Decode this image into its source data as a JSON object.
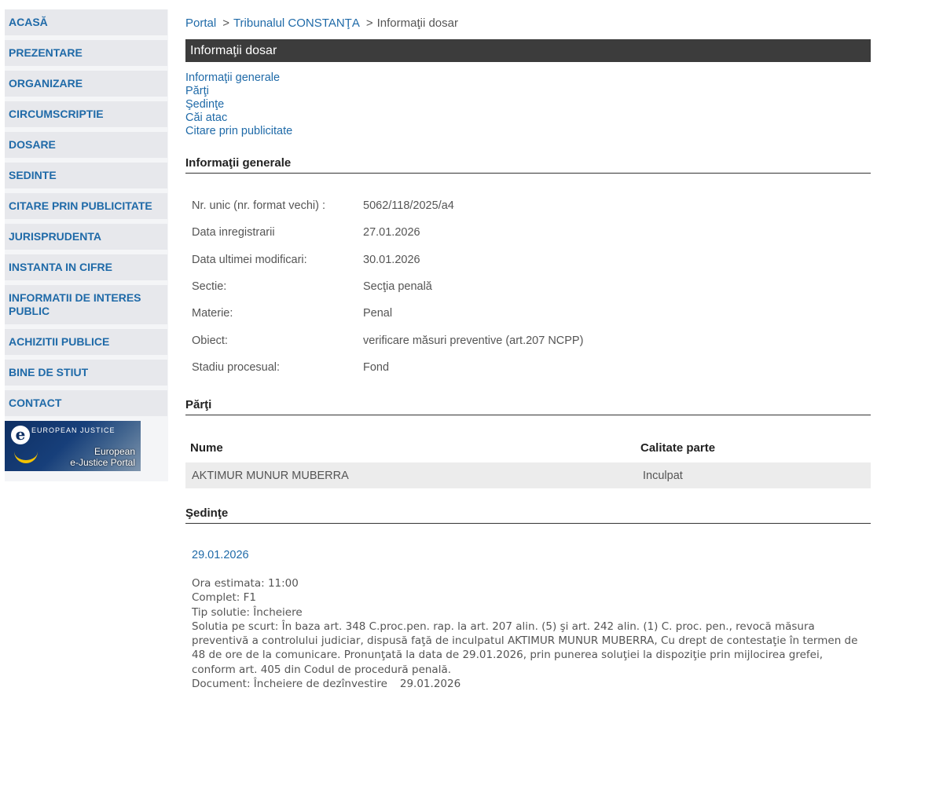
{
  "sidebar": {
    "items": [
      {
        "label": "ACASĂ"
      },
      {
        "label": "PREZENTARE"
      },
      {
        "label": "ORGANIZARE"
      },
      {
        "label": "CIRCUMSCRIPTIE"
      },
      {
        "label": "DOSARE"
      },
      {
        "label": "SEDINTE"
      },
      {
        "label": "CITARE PRIN PUBLICITATE"
      },
      {
        "label": "JURISPRUDENTA"
      },
      {
        "label": "INSTANTA IN CIFRE"
      },
      {
        "label": "INFORMATII DE INTERES PUBLIC"
      },
      {
        "label": "ACHIZITII PUBLICE"
      },
      {
        "label": "BINE DE STIUT"
      },
      {
        "label": "CONTACT"
      }
    ],
    "banner": {
      "logo_top": "EUROPEAN JUSTICE",
      "line1": "European",
      "line2": "e-Justice Portal"
    }
  },
  "breadcrumb": {
    "items": [
      "Portal",
      "Tribunalul CONSTANŢA",
      "Informaţii dosar"
    ]
  },
  "page_title": "Informaţii dosar",
  "anchors": [
    "Informaţii generale",
    "Părţi",
    "Şedinţe",
    "Căi atac",
    "Citare prin publicitate"
  ],
  "general": {
    "heading": "Informaţii generale",
    "rows": [
      {
        "label": "Nr. unic (nr. format vechi) :",
        "value": "5062/118/2025/a4"
      },
      {
        "label": "Data inregistrarii",
        "value": "27.01.2026"
      },
      {
        "label": "Data ultimei modificari:",
        "value": "30.01.2026"
      },
      {
        "label": "Sectie:",
        "value": "Secţia penală"
      },
      {
        "label": "Materie:",
        "value": "Penal"
      },
      {
        "label": "Obiect:",
        "value": "verificare măsuri preventive (art.207 NCPP)"
      },
      {
        "label": "Stadiu procesual:",
        "value": "Fond"
      }
    ]
  },
  "parti": {
    "heading": "Părţi",
    "col_nume": "Nume",
    "col_calitate": "Calitate parte",
    "rows": [
      {
        "nume": "AKTIMUR MUNUR MUBERRA",
        "calitate": "Inculpat"
      }
    ]
  },
  "sedinte": {
    "heading": "Şedinţe",
    "items": [
      {
        "date": "29.01.2026",
        "ora": "Ora estimata: 11:00",
        "complet": "Complet: F1",
        "tip": "Tip solutie: Încheiere",
        "solutia": "Solutia pe scurt: În baza art. 348 C.proc.pen. rap. la art. 207 alin. (5) şi art. 242 alin. (1) C. proc. pen., revocă măsura preventivă a controlului judiciar, dispusă faţă de inculpatul AKTIMUR MUNUR MUBERRA, Cu drept de contestaţie în termen de 48 de ore de la comunicare. Pronunţată la data de 29.01.2026, prin punerea soluţiei la dispoziţie prin mijlocirea grefei, conform art. 405 din Codul de procedură penală.",
        "document": "Document: Încheiere de dezînvestire",
        "document_date": "29.01.2026"
      }
    ]
  }
}
